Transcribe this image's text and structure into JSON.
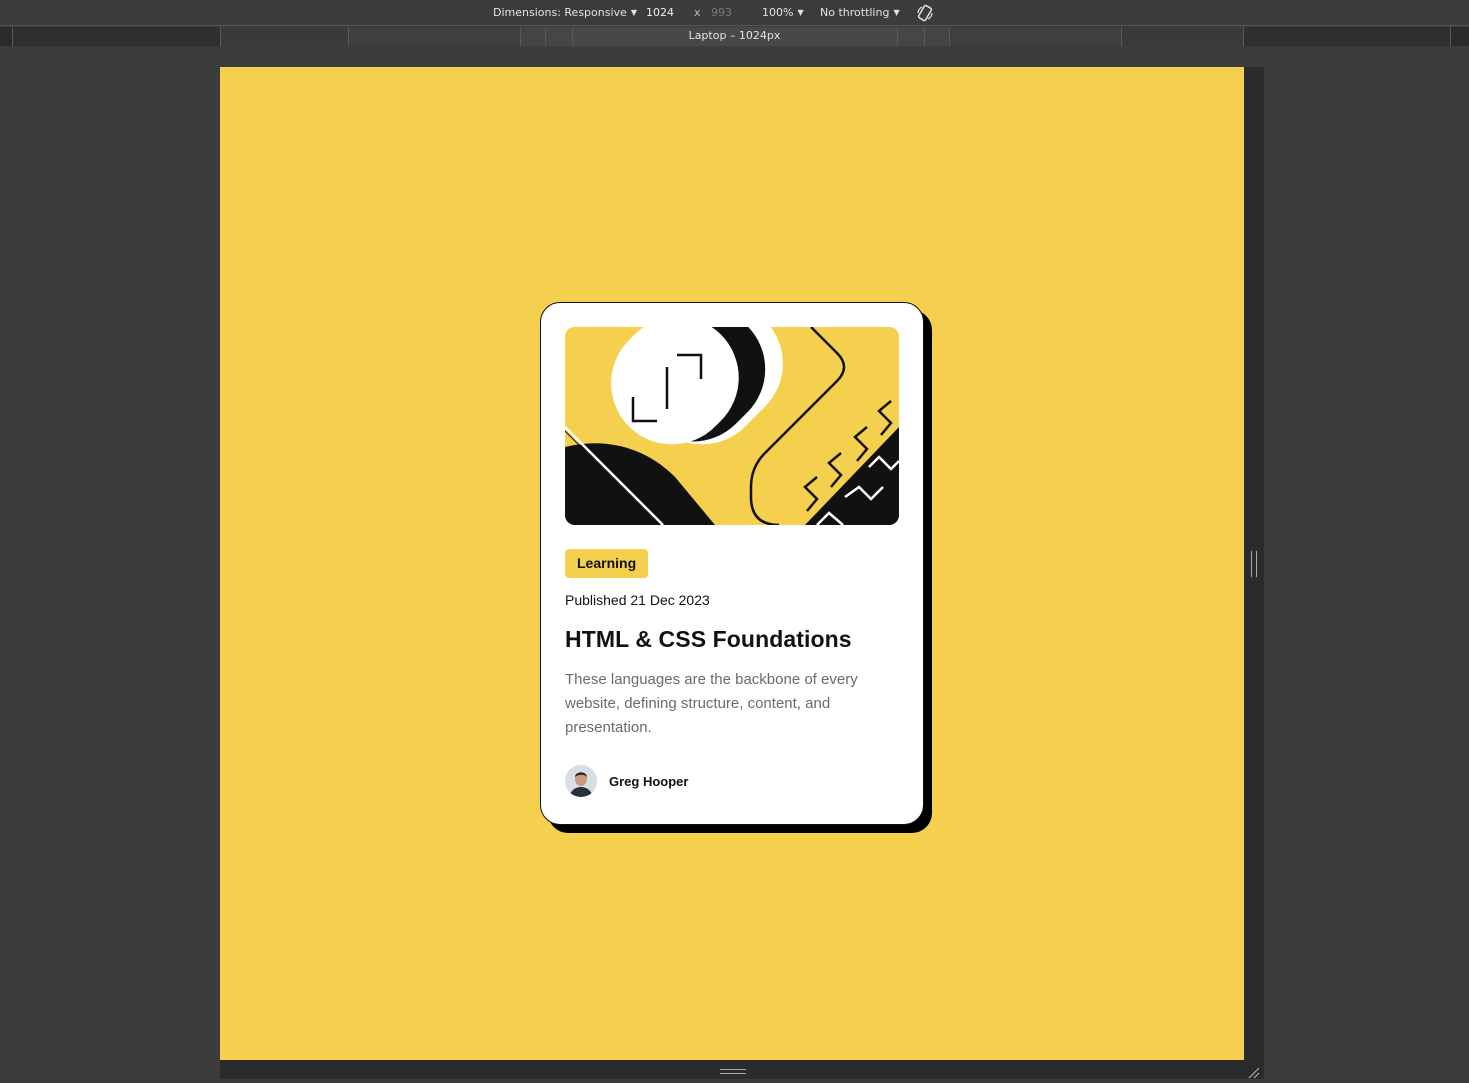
{
  "devtools": {
    "dimensions_label": "Dimensions: Responsive",
    "width": "1024",
    "times": "x",
    "height": "993",
    "zoom": "100%",
    "throttling": "No throttling",
    "media_query_label": "Laptop – 1024px",
    "rotate_icon": "rotate-icon"
  },
  "page": {
    "background_color": "#f4d04e",
    "card": {
      "tag": "Learning",
      "published": "Published 21 Dec 2023",
      "title": "HTML & CSS Foundations",
      "description": "These languages are the backbone of every website, defining structure, content, and presentation.",
      "author": "Greg Hooper"
    }
  }
}
